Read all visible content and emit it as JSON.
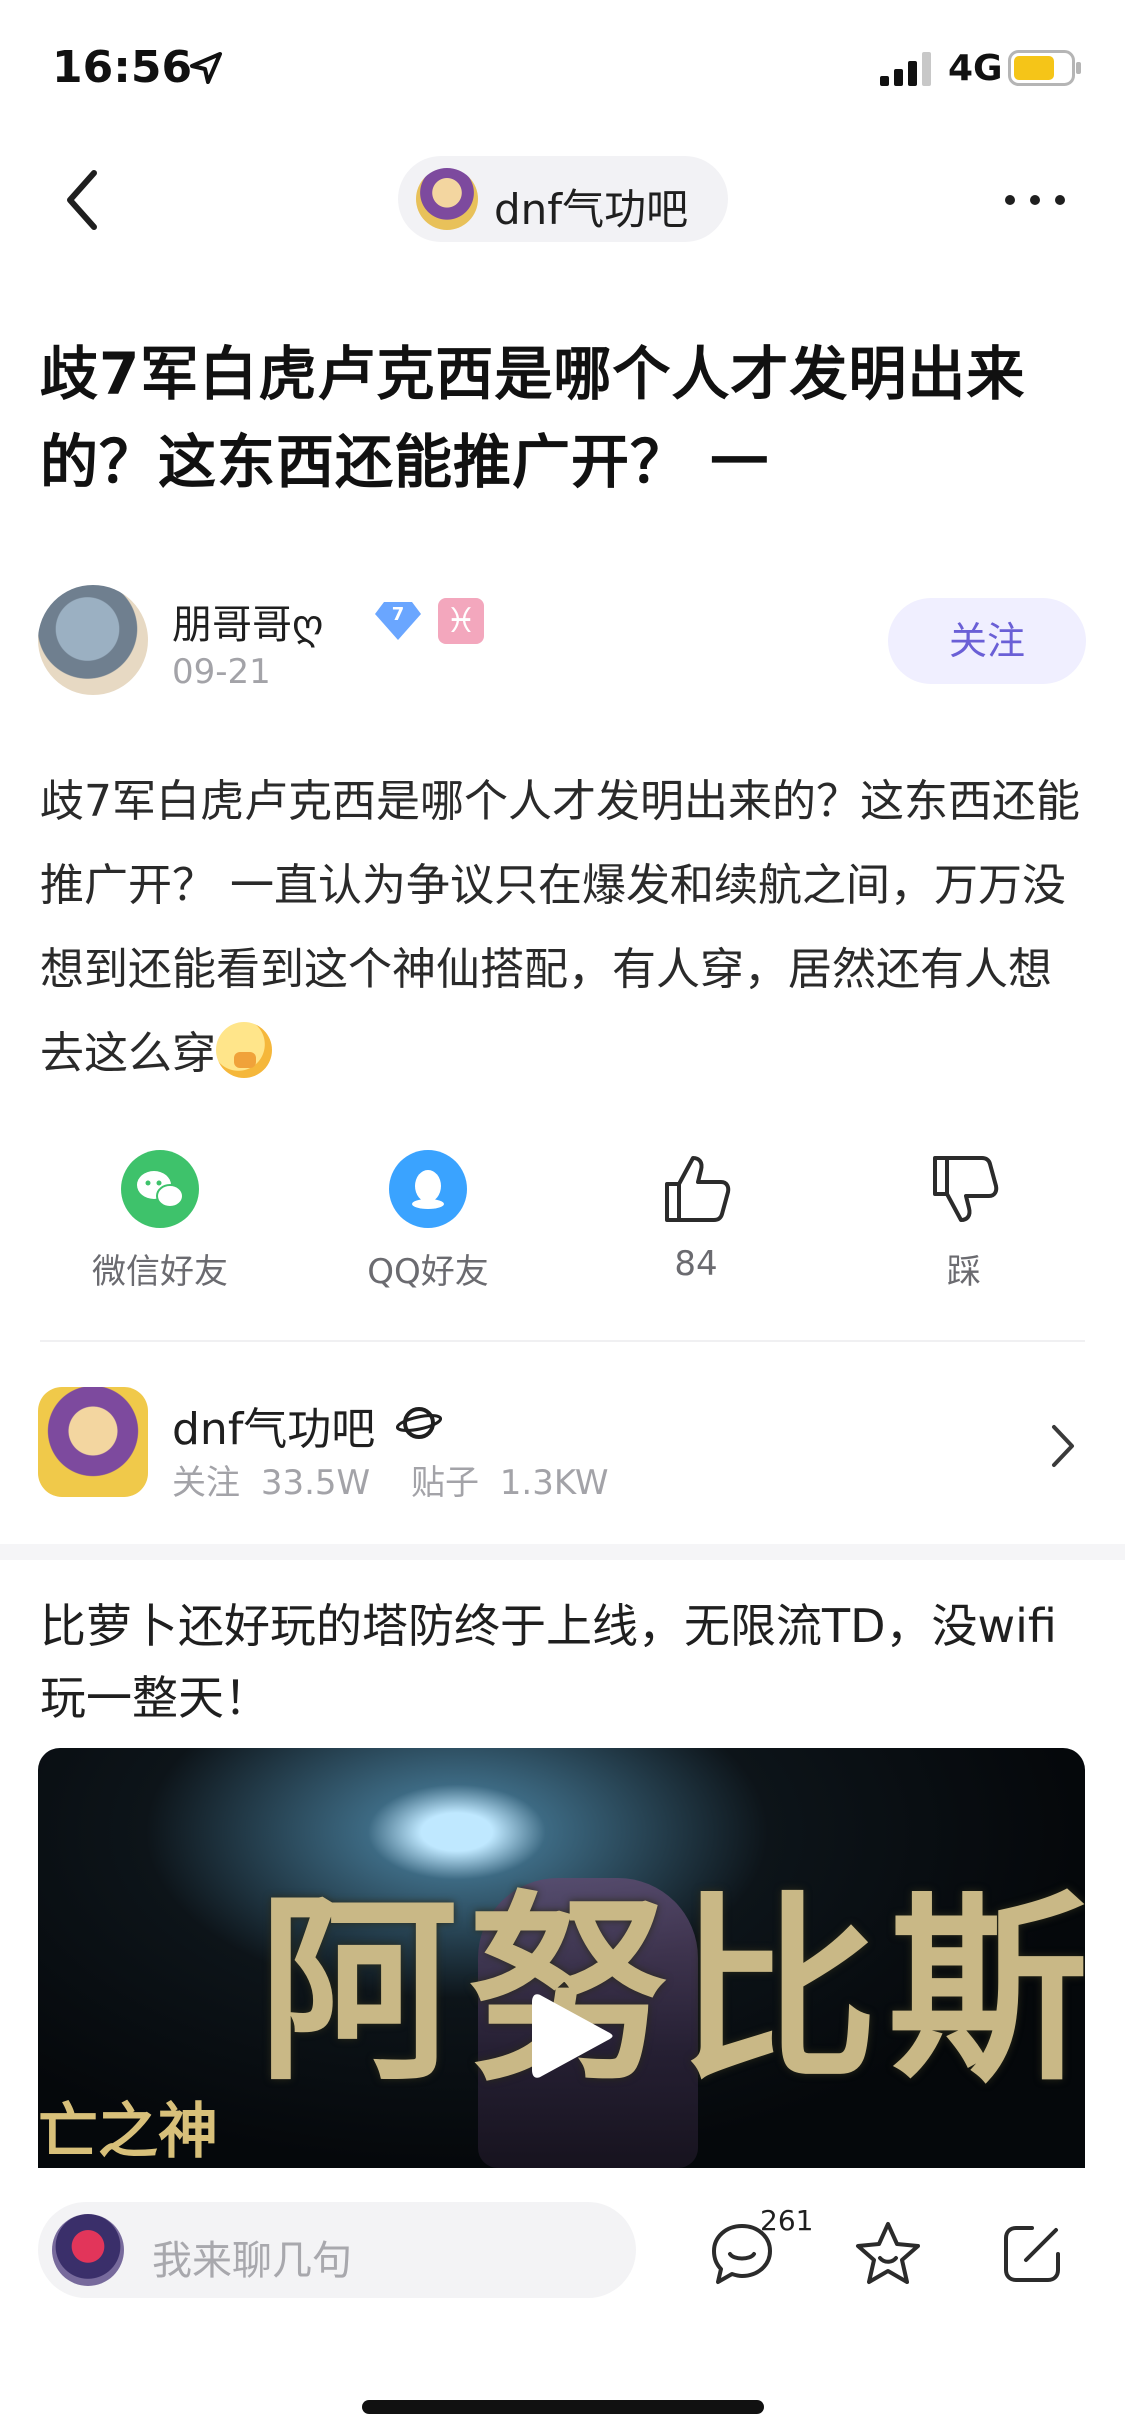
{
  "status_bar": {
    "time": "16:56",
    "network": "4G",
    "battery_color": "#f5c518"
  },
  "nav": {
    "forum_name": "dnf气功吧"
  },
  "post": {
    "title": "歧7军白虎卢克西是哪个人才发明出来的？这东西还能推广开？ 一",
    "author": {
      "name": "朋哥哥ღ",
      "level": "7",
      "zodiac": "♓",
      "date": "09-21"
    },
    "follow_label": "关注",
    "body": "歧7军白虎卢克西是哪个人才发明出来的？这东西还能推广开？ 一直认为争议只在爆发和续航之间，万万没想到还能看到这个神仙搭配，有人穿，居然还有人想去这么穿",
    "emoji": "face-with-hand-over-mouth"
  },
  "actions": {
    "wechat": "微信好友",
    "qq": "QQ好友",
    "like_count": "84",
    "dislike": "踩"
  },
  "forum_card": {
    "name": "dnf气功吧",
    "followers_label": "关注",
    "followers": "33.5W",
    "posts_label": "贴子",
    "posts": "1.3KW"
  },
  "ad": {
    "title": "比萝卜还好玩的塔防终于上线，无限流TD，没wifi玩一整天！",
    "video_text": "阿努比斯",
    "video_subtext": "亡之神"
  },
  "bottom_bar": {
    "comment_placeholder": "我来聊几句",
    "comment_count": "261"
  },
  "colors": {
    "accent": "#6a5fd6",
    "wechat": "#3ec26b",
    "qq": "#3aa3ff"
  }
}
